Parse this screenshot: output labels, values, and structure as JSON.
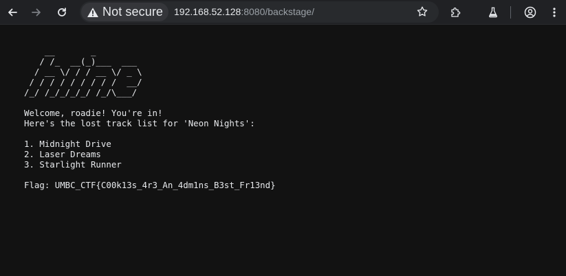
{
  "browser": {
    "security_label": "Not secure",
    "url_host": "192.168.52.128",
    "url_rest": ":8080/backstage/"
  },
  "page": {
    "ascii_art": [
      "    __       _",
      "   / /_  __(_)___  ___",
      "  / __ \\/ / / __ \\/ _ \\",
      " / / / / / / / / /  __/",
      "/_/ /_/_/_/_/ /_/\\___/"
    ],
    "welcome": "Welcome, roadie! You're in!",
    "intro": "Here's the lost track list for 'Neon Nights':",
    "tracks": [
      "1. Midnight Drive",
      "2. Laser Dreams",
      "3. Starlight Runner"
    ],
    "flag": "Flag: UMBC_CTF{C00k13s_4r3_An_4dm1ns_B3st_Fr13nd}"
  }
}
